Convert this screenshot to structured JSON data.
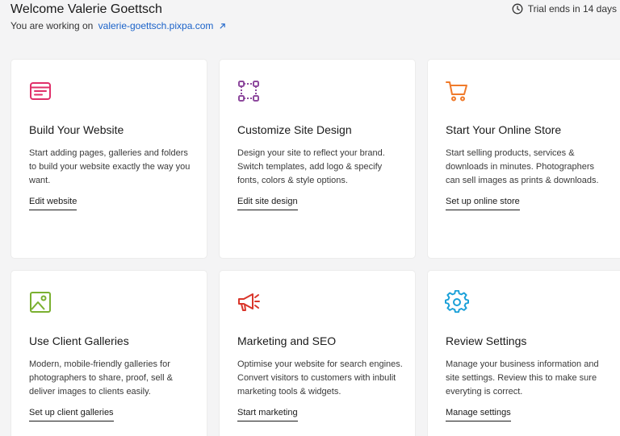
{
  "header": {
    "welcome": "Welcome Valerie Goettsch",
    "working_prefix": "You are working on",
    "site_url": "valerie-goettsch.pixpa.com",
    "trial": "Trial ends in 14 days"
  },
  "cards": [
    {
      "title": "Build Your Website",
      "description": "Start adding pages, galleries and folders to build your website exactly the way you want.",
      "link": "Edit website",
      "icon": "browser-window-icon",
      "color": "#e0306a"
    },
    {
      "title": "Customize Site Design",
      "description": "Design your site to reflect your brand. Switch templates, add logo & specify fonts, colors & style options.",
      "link": "Edit site design",
      "icon": "design-nodes-icon",
      "color": "#8e4a9e"
    },
    {
      "title": "Start Your Online Store",
      "description": "Start selling products, services & downloads in minutes. Photographers can sell images as prints & downloads.",
      "link": "Set up online store",
      "icon": "shopping-cart-icon",
      "color": "#f07a2a"
    },
    {
      "title": "Use Client Galleries",
      "description": "Modern, mobile-friendly galleries for photographers to share, proof, sell & deliver images to clients easily.",
      "link": "Set up client galleries",
      "icon": "image-icon",
      "color": "#7ab030"
    },
    {
      "title": "Marketing and SEO",
      "description": "Optimise your website for search engines. Convert visitors to customers with inbulit marketing tools & widgets.",
      "link": "Start marketing",
      "icon": "megaphone-icon",
      "color": "#d9352a"
    },
    {
      "title": "Review Settings",
      "description": "Manage your business information and site settings. Review this to make sure everyting is correct.",
      "link": "Manage settings",
      "icon": "gear-icon",
      "color": "#1aa0d8"
    }
  ]
}
